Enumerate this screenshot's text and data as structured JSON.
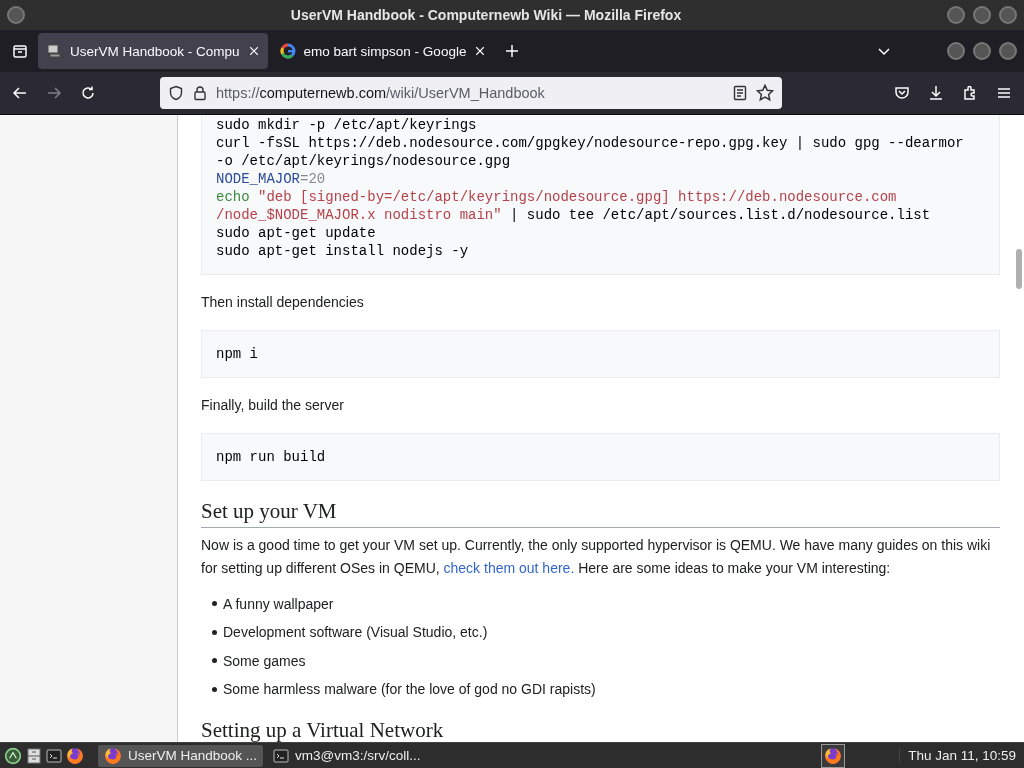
{
  "window": {
    "title": "UserVM Handbook - Computernewb Wiki — Mozilla Firefox"
  },
  "tabs": [
    {
      "title": "UserVM Handbook - Compu",
      "selected": true,
      "kind": "computer"
    },
    {
      "title": "emo bart simpson - Google",
      "selected": false,
      "kind": "google"
    }
  ],
  "toolbar": {
    "forward": {
      "disabled": true
    },
    "url": {
      "scheme": "https://",
      "domain": "computernewb.com",
      "path": "/wiki/UserVM_Handbook"
    }
  },
  "article": [
    {
      "kind": "code",
      "lines": [
        [
          {
            "text": "sudo mkdir -p /etc/apt/keyrings",
            "kind": "plain"
          }
        ],
        [
          {
            "text": "curl -fsSL https://deb.nodesource.com/gpgkey/nodesource-repo.gpg.key | sudo gpg --dearmor",
            "kind": "plain"
          }
        ],
        [
          {
            "text": "-o /etc/apt/keyrings/nodesource.gpg",
            "kind": "plain"
          }
        ],
        [
          {
            "text": "NODE_MAJOR",
            "kind": "var"
          },
          {
            "text": "=20",
            "kind": "num"
          }
        ],
        [
          {
            "text": "echo ",
            "kind": "cmd"
          },
          {
            "text": "\"deb [signed-by=/etc/apt/keyrings/nodesource.gpg] https://deb.nodesource.com",
            "kind": "str"
          }
        ],
        [
          {
            "text": "/node_$NODE_MAJOR.x nodistro main\"",
            "kind": "str"
          },
          {
            "text": " | sudo tee /etc/apt/sources.list.d/nodesource.list",
            "kind": "plain"
          }
        ],
        [
          {
            "text": "sudo apt-get update",
            "kind": "plain"
          }
        ],
        [
          {
            "text": "sudo apt-get install nodejs -y",
            "kind": "plain"
          }
        ]
      ]
    },
    {
      "kind": "paragraph",
      "text": "Then install dependencies"
    },
    {
      "kind": "code",
      "lines": [
        [
          {
            "text": "npm i",
            "kind": "plain"
          }
        ]
      ]
    },
    {
      "kind": "paragraph",
      "text": "Finally, build the server"
    },
    {
      "kind": "code",
      "lines": [
        [
          {
            "text": "npm run build",
            "kind": "plain"
          }
        ]
      ]
    },
    {
      "kind": "heading",
      "text": "Set up your VM"
    },
    {
      "kind": "paragraph",
      "text": "Now is a good time to get your VM set up. Currently, the only supported hypervisor is QEMU. We have many guides on this wiki for setting up different OSes in QEMU, ",
      "link": "check them out here.",
      "after": " Here are some ideas to make your VM interesting:"
    },
    {
      "kind": "list",
      "items": [
        "A funny wallpaper",
        "Development software (Visual Studio, etc.)",
        "Some games",
        "Some harmless malware (for the love of god no GDI rapists)"
      ]
    },
    {
      "kind": "heading",
      "text": "Setting up a Virtual Network"
    }
  ],
  "taskbar": {
    "tasks": [
      {
        "label": "UserVM Handbook ...",
        "selected": true,
        "kind": "firefox"
      },
      {
        "label": "vm3@vm3:/srv/coll...",
        "selected": false,
        "kind": "terminal"
      }
    ],
    "clock": "Thu Jan 11, 10:59"
  }
}
